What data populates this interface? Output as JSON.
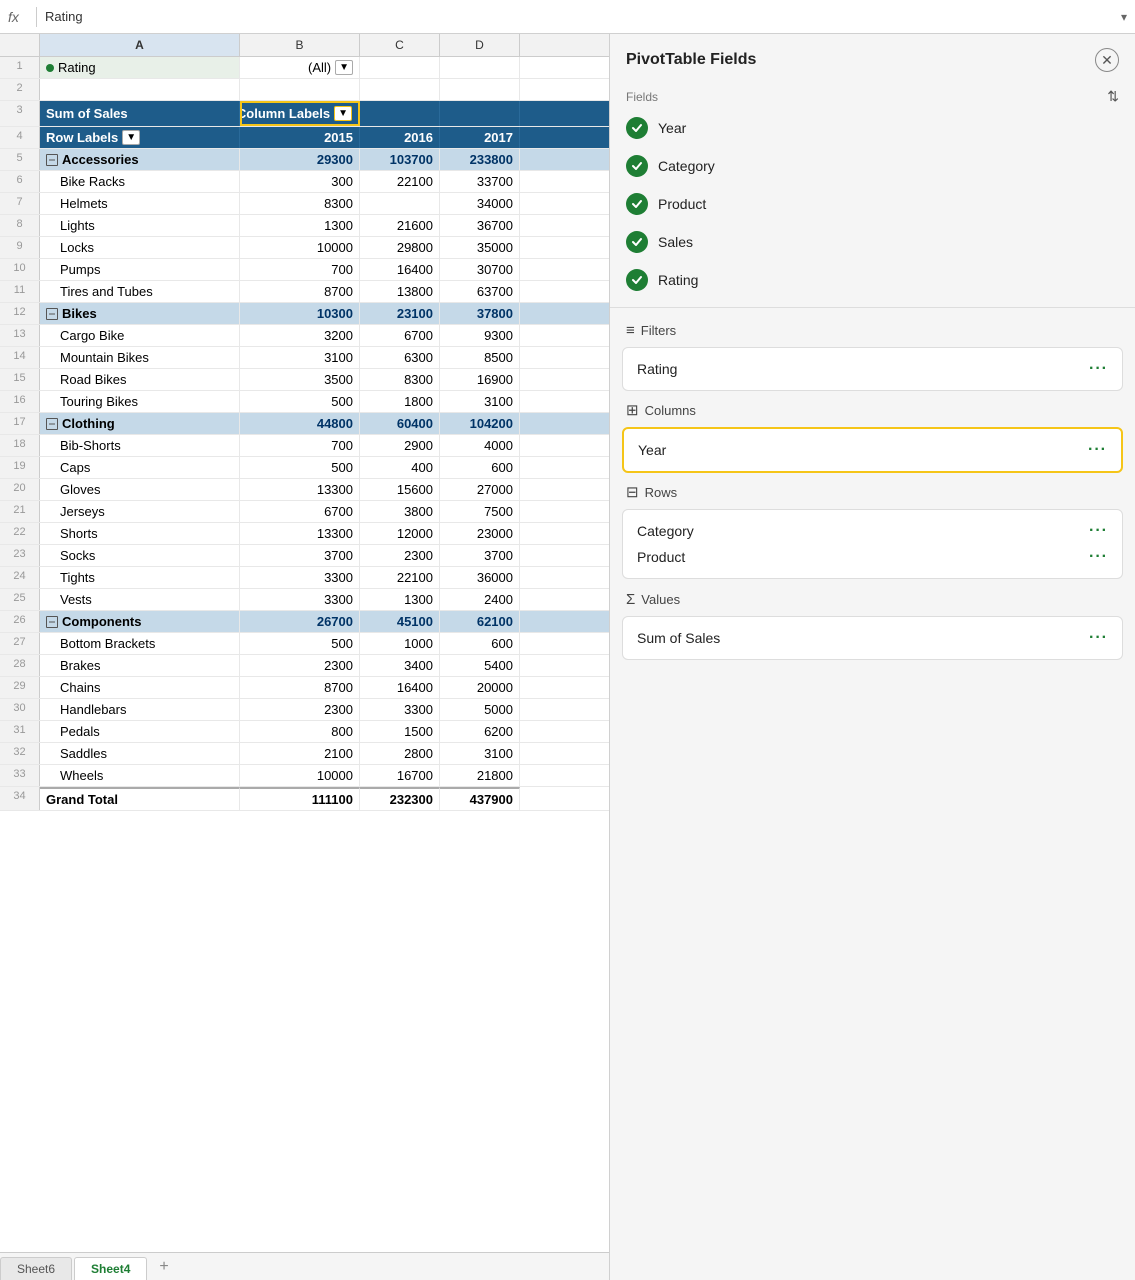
{
  "formula_bar": {
    "fx": "fx",
    "content": "Rating",
    "chevron": "▾"
  },
  "columns": {
    "row_num_header": "",
    "a": "A",
    "b": "B",
    "c": "C",
    "d": "D"
  },
  "rows": [
    {
      "num": "1",
      "a": "Rating",
      "b": "(All)",
      "c": "",
      "d": "",
      "type": "rating"
    },
    {
      "num": "2",
      "a": "",
      "b": "",
      "c": "",
      "d": "",
      "type": "empty"
    },
    {
      "num": "3",
      "a": "Sum of Sales",
      "b": "Column Labels",
      "c": "",
      "d": "",
      "type": "header"
    },
    {
      "num": "4",
      "a": "Row Labels",
      "b": "2015",
      "c": "2016",
      "d": "2017",
      "type": "col-labels"
    },
    {
      "num": "5",
      "a": "Accessories",
      "b": "29300",
      "c": "103700",
      "d": "233800",
      "type": "category"
    },
    {
      "num": "6",
      "a": "Bike Racks",
      "b": "300",
      "c": "22100",
      "d": "33700",
      "type": "product"
    },
    {
      "num": "7",
      "a": "Helmets",
      "b": "8300",
      "c": "",
      "d": "34000",
      "type": "product"
    },
    {
      "num": "8",
      "a": "Lights",
      "b": "1300",
      "c": "21600",
      "d": "36700",
      "type": "product"
    },
    {
      "num": "9",
      "a": "Locks",
      "b": "10000",
      "c": "29800",
      "d": "35000",
      "type": "product"
    },
    {
      "num": "10",
      "a": "Pumps",
      "b": "700",
      "c": "16400",
      "d": "30700",
      "type": "product"
    },
    {
      "num": "11",
      "a": "Tires and Tubes",
      "b": "8700",
      "c": "13800",
      "d": "63700",
      "type": "product"
    },
    {
      "num": "12",
      "a": "Bikes",
      "b": "10300",
      "c": "23100",
      "d": "37800",
      "type": "category"
    },
    {
      "num": "13",
      "a": "Cargo Bike",
      "b": "3200",
      "c": "6700",
      "d": "9300",
      "type": "product"
    },
    {
      "num": "14",
      "a": "Mountain Bikes",
      "b": "3100",
      "c": "6300",
      "d": "8500",
      "type": "product"
    },
    {
      "num": "15",
      "a": "Road Bikes",
      "b": "3500",
      "c": "8300",
      "d": "16900",
      "type": "product"
    },
    {
      "num": "16",
      "a": "Touring Bikes",
      "b": "500",
      "c": "1800",
      "d": "3100",
      "type": "product"
    },
    {
      "num": "17",
      "a": "Clothing",
      "b": "44800",
      "c": "60400",
      "d": "104200",
      "type": "category"
    },
    {
      "num": "18",
      "a": "Bib-Shorts",
      "b": "700",
      "c": "2900",
      "d": "4000",
      "type": "product"
    },
    {
      "num": "19",
      "a": "Caps",
      "b": "500",
      "c": "400",
      "d": "600",
      "type": "product"
    },
    {
      "num": "20",
      "a": "Gloves",
      "b": "13300",
      "c": "15600",
      "d": "27000",
      "type": "product"
    },
    {
      "num": "21",
      "a": "Jerseys",
      "b": "6700",
      "c": "3800",
      "d": "7500",
      "type": "product"
    },
    {
      "num": "22",
      "a": "Shorts",
      "b": "13300",
      "c": "12000",
      "d": "23000",
      "type": "product"
    },
    {
      "num": "23",
      "a": "Socks",
      "b": "3700",
      "c": "2300",
      "d": "3700",
      "type": "product"
    },
    {
      "num": "24",
      "a": "Tights",
      "b": "3300",
      "c": "22100",
      "d": "36000",
      "type": "product"
    },
    {
      "num": "25",
      "a": "Vests",
      "b": "3300",
      "c": "1300",
      "d": "2400",
      "type": "product"
    },
    {
      "num": "26",
      "a": "Components",
      "b": "26700",
      "c": "45100",
      "d": "62100",
      "type": "category"
    },
    {
      "num": "27",
      "a": "Bottom Brackets",
      "b": "500",
      "c": "1000",
      "d": "600",
      "type": "product"
    },
    {
      "num": "28",
      "a": "Brakes",
      "b": "2300",
      "c": "3400",
      "d": "5400",
      "type": "product"
    },
    {
      "num": "29",
      "a": "Chains",
      "b": "8700",
      "c": "16400",
      "d": "20000",
      "type": "product"
    },
    {
      "num": "30",
      "a": "Handlebars",
      "b": "2300",
      "c": "3300",
      "d": "5000",
      "type": "product"
    },
    {
      "num": "31",
      "a": "Pedals",
      "b": "800",
      "c": "1500",
      "d": "6200",
      "type": "product"
    },
    {
      "num": "32",
      "a": "Saddles",
      "b": "2100",
      "c": "2800",
      "d": "3100",
      "type": "product"
    },
    {
      "num": "33",
      "a": "Wheels",
      "b": "10000",
      "c": "16700",
      "d": "21800",
      "type": "product"
    },
    {
      "num": "34",
      "a": "Grand Total",
      "b": "111100",
      "c": "232300",
      "d": "437900",
      "type": "grand-total"
    }
  ],
  "sheet_tabs": {
    "inactive": "Sheet6",
    "active": "Sheet4",
    "add": "+"
  },
  "pivot_panel": {
    "title": "PivotTable Fields",
    "close": "✕",
    "fields_label": "Fields",
    "sort_icon": "⇅",
    "fields": [
      {
        "name": "Year",
        "checked": true
      },
      {
        "name": "Category",
        "checked": true
      },
      {
        "name": "Product",
        "checked": true
      },
      {
        "name": "Sales",
        "checked": true
      },
      {
        "name": "Rating",
        "checked": true
      }
    ],
    "filters_label": "Filters",
    "filters_icon": "≡",
    "filter_items": [
      {
        "name": "Rating",
        "dots": "···"
      }
    ],
    "columns_label": "Columns",
    "columns_icon": "⊞",
    "column_items": [
      {
        "name": "Year",
        "dots": "···"
      }
    ],
    "rows_label": "Rows",
    "rows_icon": "⊟",
    "row_items": [
      {
        "name": "Category",
        "dots": "···"
      },
      {
        "name": "Product",
        "dots": "···"
      }
    ],
    "values_label": "Values",
    "values_icon": "Σ",
    "value_items": [
      {
        "name": "Sum of Sales",
        "dots": "···"
      }
    ]
  }
}
